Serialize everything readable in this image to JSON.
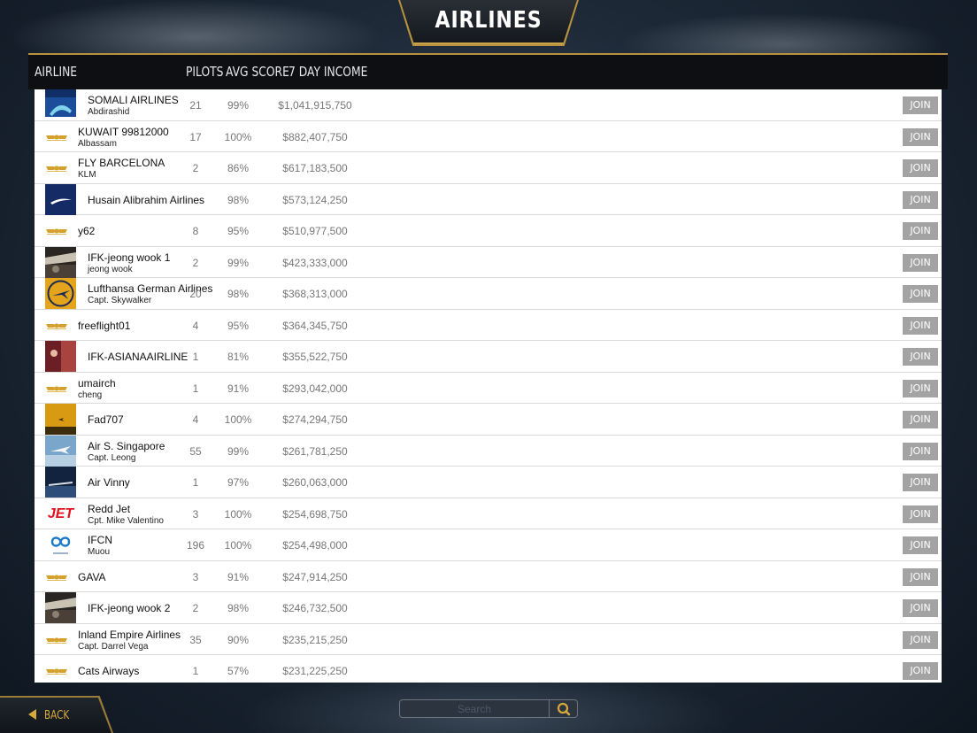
{
  "header": {
    "title": "AIRLINES"
  },
  "columns": {
    "airline": "AIRLINE",
    "pilots": "PILOTS",
    "avg_score": "AVG SCORE",
    "income": "7 DAY INCOME"
  },
  "rows": [
    {
      "name": "SOMALI AIRLINES",
      "owner": "Abdirashid",
      "pilots": "21",
      "score": "99%",
      "income": "$1,041,915,750",
      "join": "JOIN",
      "logo": "somali-logo-icon"
    },
    {
      "name": "KUWAIT 99812000",
      "owner": "Albassam",
      "pilots": "17",
      "score": "100%",
      "income": "$882,407,750",
      "join": "JOIN",
      "logo": "wings-icon"
    },
    {
      "name": "FLY BARCELONA",
      "owner": "KLM",
      "pilots": "2",
      "score": "86%",
      "income": "$617,183,500",
      "join": "JOIN",
      "logo": "wings-icon"
    },
    {
      "name": "Husain Alibrahim Airlines",
      "owner": "",
      "pilots": "",
      "score": "98%",
      "income": "$573,124,250",
      "join": "JOIN",
      "logo": "blue-swoosh-logo-icon"
    },
    {
      "name": "y62",
      "owner": "",
      "pilots": "8",
      "score": "95%",
      "income": "$510,977,500",
      "join": "JOIN",
      "logo": "wings-icon"
    },
    {
      "name": "IFK-jeong wook 1",
      "owner": "jeong wook",
      "pilots": "2",
      "score": "99%",
      "income": "$423,333,000",
      "join": "JOIN",
      "logo": "cockpit-photo-icon"
    },
    {
      "name": "Lufthansa German Airlines",
      "owner": "Capt. Skywalker",
      "pilots": "20",
      "score": "98%",
      "income": "$368,313,000",
      "join": "JOIN",
      "logo": "crane-logo-icon"
    },
    {
      "name": "freeflight01",
      "owner": "",
      "pilots": "4",
      "score": "95%",
      "income": "$364,345,750",
      "join": "JOIN",
      "logo": "wings-icon"
    },
    {
      "name": "IFK-ASIANAAIRLINE",
      "owner": "",
      "pilots": "1",
      "score": "81%",
      "income": "$355,522,750",
      "join": "JOIN",
      "logo": "red-photo-icon"
    },
    {
      "name": "umairch",
      "owner": "cheng",
      "pilots": "1",
      "score": "91%",
      "income": "$293,042,000",
      "join": "JOIN",
      "logo": "wings-icon"
    },
    {
      "name": "Fad707",
      "owner": "",
      "pilots": "4",
      "score": "100%",
      "income": "$274,294,750",
      "join": "JOIN",
      "logo": "sunset-plane-icon"
    },
    {
      "name": "Air S. Singapore",
      "owner": "Capt. Leong",
      "pilots": "55",
      "score": "99%",
      "income": "$261,781,250",
      "join": "JOIN",
      "logo": "sky-plane-icon"
    },
    {
      "name": "Air Vinny",
      "owner": "",
      "pilots": "1",
      "score": "97%",
      "income": "$260,063,000",
      "join": "JOIN",
      "logo": "night-plane-icon"
    },
    {
      "name": "Redd Jet",
      "owner": "Cpt. Mike Valentino",
      "pilots": "3",
      "score": "100%",
      "income": "$254,698,750",
      "join": "JOIN",
      "logo": "jet-logo-icon",
      "logo_text": "JET"
    },
    {
      "name": "IFCN",
      "owner": "Muou",
      "pilots": "196",
      "score": "100%",
      "income": "$254,498,000",
      "join": "JOIN",
      "logo": "infinity-logo-icon"
    },
    {
      "name": "GAVA",
      "owner": "",
      "pilots": "3",
      "score": "91%",
      "income": "$247,914,250",
      "join": "JOIN",
      "logo": "wings-icon"
    },
    {
      "name": "IFK-jeong wook 2",
      "owner": "",
      "pilots": "2",
      "score": "98%",
      "income": "$246,732,500",
      "join": "JOIN",
      "logo": "cockpit-photo-icon"
    },
    {
      "name": "Inland Empire Airlines",
      "owner": "Capt. Darrel Vega",
      "pilots": "35",
      "score": "90%",
      "income": "$235,215,250",
      "join": "JOIN",
      "logo": "wings-icon"
    },
    {
      "name": "Cats Airways",
      "owner": "",
      "pilots": "1",
      "score": "57%",
      "income": "$231,225,250",
      "join": "JOIN",
      "logo": "wings-icon"
    }
  ],
  "footer": {
    "back_label": "BACK",
    "search_placeholder": "Search"
  },
  "colors": {
    "gold": "#b8923e",
    "join_button": "#a3a3a3",
    "header_bg": "#0d0f12"
  }
}
